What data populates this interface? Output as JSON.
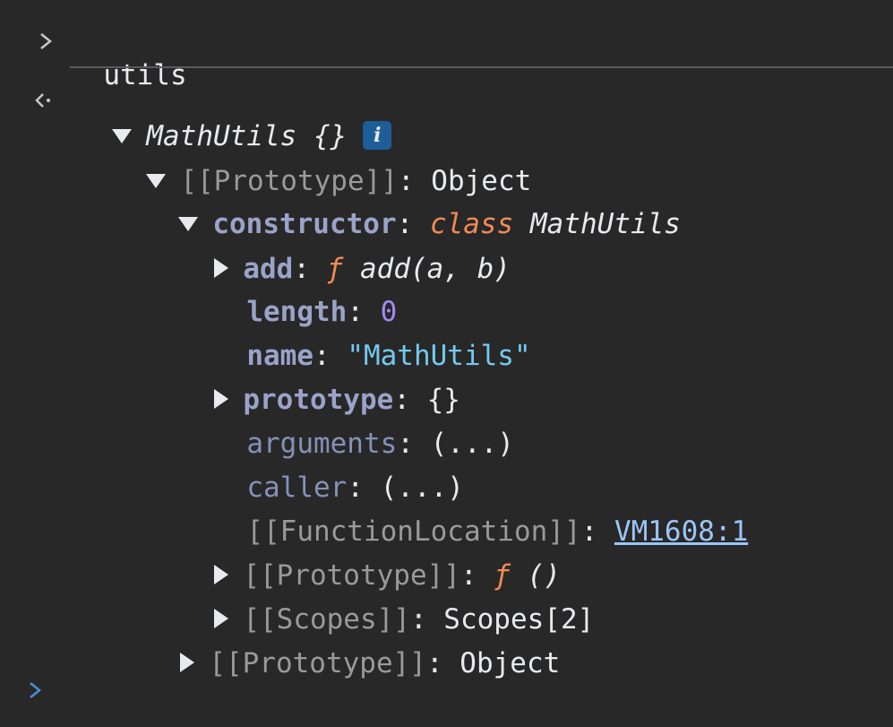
{
  "console": {
    "input_command": "utils",
    "result": {
      "object_name": "MathUtils",
      "object_braces": "{}",
      "info_badge": "i",
      "proto_key": "[[Prototype]]",
      "proto_value": "Object",
      "constructor": {
        "key": "constructor",
        "class_keyword": "class",
        "class_name": "MathUtils",
        "props": {
          "add_key": "add",
          "add_f": "ƒ",
          "add_sig": "add(a, b)",
          "length_key": "length",
          "length_value": "0",
          "name_key": "name",
          "name_value": "\"MathUtils\"",
          "prototype_key": "prototype",
          "prototype_value": "{}",
          "arguments_key": "arguments",
          "arguments_value": "(...)",
          "caller_key": "caller",
          "caller_value": "(...)",
          "function_location_key": "[[FunctionLocation]]",
          "function_location_value": "VM1608:1",
          "inner_proto_key": "[[Prototype]]",
          "inner_proto_f": "ƒ",
          "inner_proto_sig": "()",
          "scopes_key": "[[Scopes]]",
          "scopes_value": "Scopes[2]"
        }
      },
      "outer_proto_key": "[[Prototype]]",
      "outer_proto_value": "Object"
    },
    "colors": {
      "background": "#282828",
      "property_key": "#9aa3c8",
      "internal_key": "#9a9a9a",
      "keyword": "#f28b54",
      "number": "#9f8cf0",
      "string": "#74c9f0",
      "link": "#9cc5f7",
      "info_badge": "#1f5d99"
    }
  }
}
